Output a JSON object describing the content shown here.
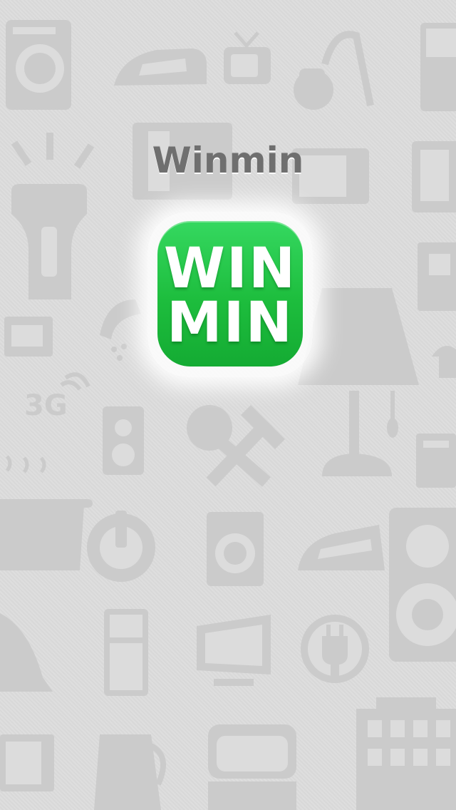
{
  "app": {
    "title": "Winmin",
    "logo_line1": "WIN",
    "logo_line2": "MIN",
    "brand_color": "#1fc244"
  },
  "background": {
    "badge_text": "3G",
    "icons": [
      "washing-machine-icon",
      "iron-icon",
      "tv-icon",
      "vacuum-cleaner-icon",
      "refrigerator-icon",
      "flashlight-icon",
      "microwave-icon",
      "lamp-icon",
      "speaker-icon",
      "cutlery-icon",
      "cooking-pot-icon",
      "power-icon",
      "plug-icon",
      "kettle-icon",
      "bed-icon",
      "building-icon",
      "monitor-icon",
      "shower-icon",
      "mop-icon"
    ]
  }
}
